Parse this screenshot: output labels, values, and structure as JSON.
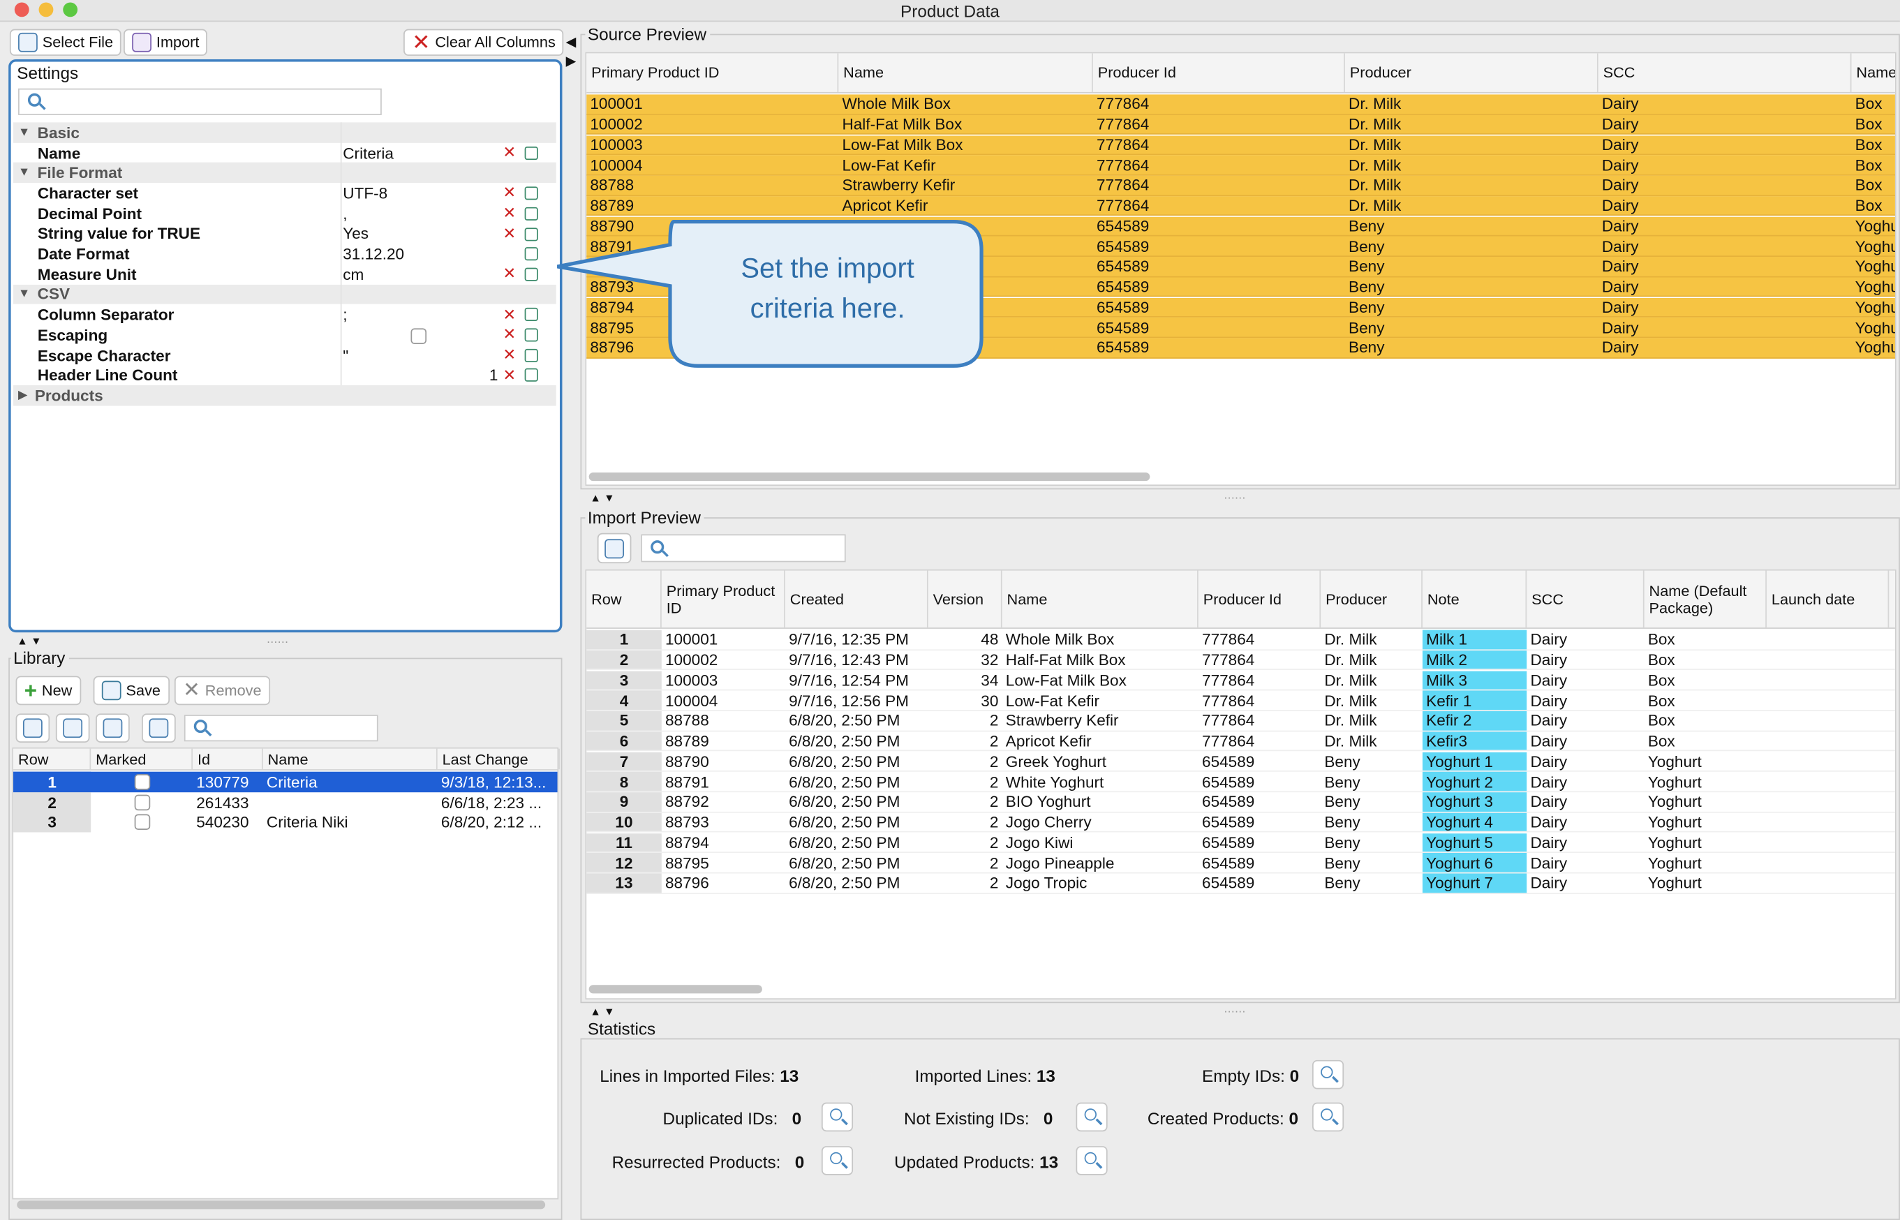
{
  "window": {
    "title": "Product Data"
  },
  "toolbar": {
    "select_file": "Select File",
    "import": "Import",
    "clear_all": "Clear All Columns"
  },
  "settings": {
    "title": "Settings",
    "groups": [
      {
        "label": "Basic",
        "items": [
          {
            "k": "Name",
            "v": "Criteria",
            "x": true
          }
        ]
      },
      {
        "label": "File Format",
        "items": [
          {
            "k": "Character set",
            "v": "UTF-8",
            "x": true
          },
          {
            "k": "Decimal Point",
            "v": ",",
            "x": true
          },
          {
            "k": "String value for TRUE",
            "v": "Yes",
            "x": true
          },
          {
            "k": "Date Format",
            "v": "31.12.20",
            "x": false
          },
          {
            "k": "Measure Unit",
            "v": "cm",
            "x": true
          }
        ]
      },
      {
        "label": "CSV",
        "items": [
          {
            "k": "Column Separator",
            "v": ";",
            "x": true
          },
          {
            "k": "Escaping",
            "v": "",
            "x": true,
            "checkbox": true
          },
          {
            "k": "Escape Character",
            "v": "\"",
            "x": true
          },
          {
            "k": "Header Line Count",
            "v": "1",
            "x": true,
            "right": true
          }
        ]
      }
    ],
    "collapsed_group": "Products"
  },
  "callout": {
    "line1": "Set the import",
    "line2": "criteria here."
  },
  "library": {
    "title": "Library",
    "new": "New",
    "save": "Save",
    "remove": "Remove",
    "columns": [
      "Row",
      "Marked",
      "Id",
      "Name",
      "Last Change"
    ],
    "rows": [
      {
        "row": "1",
        "id": "130779",
        "name": "Criteria",
        "last": "9/3/18, 12:13..."
      },
      {
        "row": "2",
        "id": "261433",
        "name": "",
        "last": "6/6/18, 2:23 ..."
      },
      {
        "row": "3",
        "id": "540230",
        "name": "Criteria Niki",
        "last": "6/8/20, 2:12 ..."
      }
    ]
  },
  "source": {
    "title": "Source Preview",
    "columns": [
      "Primary Product ID",
      "Name",
      "Producer Id",
      "Producer",
      "SCC",
      "Name"
    ],
    "rows": [
      [
        "100001",
        "Whole Milk Box",
        "777864",
        "Dr. Milk",
        "Dairy",
        "Box"
      ],
      [
        "100002",
        "Half-Fat Milk Box",
        "777864",
        "Dr. Milk",
        "Dairy",
        "Box"
      ],
      [
        "100003",
        "Low-Fat Milk Box",
        "777864",
        "Dr. Milk",
        "Dairy",
        "Box"
      ],
      [
        "100004",
        "Low-Fat Kefir",
        "777864",
        "Dr. Milk",
        "Dairy",
        "Box"
      ],
      [
        "88788",
        "Strawberry Kefir",
        "777864",
        "Dr. Milk",
        "Dairy",
        "Box"
      ],
      [
        "88789",
        "Apricot Kefir",
        "777864",
        "Dr. Milk",
        "Dairy",
        "Box"
      ],
      [
        "88790",
        "",
        "654589",
        "Beny",
        "Dairy",
        "Yoghu"
      ],
      [
        "88791",
        "",
        "654589",
        "Beny",
        "Dairy",
        "Yoghu"
      ],
      [
        "",
        "",
        "654589",
        "Beny",
        "Dairy",
        "Yoghu"
      ],
      [
        "88793",
        "",
        "654589",
        "Beny",
        "Dairy",
        "Yoghu"
      ],
      [
        "88794",
        "",
        "654589",
        "Beny",
        "Dairy",
        "Yoghu"
      ],
      [
        "88795",
        "",
        "654589",
        "Beny",
        "Dairy",
        "Yoghu"
      ],
      [
        "88796",
        "",
        "654589",
        "Beny",
        "Dairy",
        "Yoghu"
      ]
    ]
  },
  "import": {
    "title": "Import Preview",
    "columns": [
      "Row",
      "Primary Product ID",
      "Created",
      "Version",
      "Name",
      "Producer Id",
      "Producer",
      "Note",
      "SCC",
      "Name (Default Package)",
      "Launch date"
    ],
    "rows": [
      [
        "1",
        "100001",
        "9/7/16, 12:35 PM",
        "48",
        "Whole Milk Box",
        "777864",
        "Dr. Milk",
        "Milk 1",
        "Dairy",
        "Box"
      ],
      [
        "2",
        "100002",
        "9/7/16, 12:43 PM",
        "32",
        "Half-Fat Milk Box",
        "777864",
        "Dr. Milk",
        "Milk 2",
        "Dairy",
        "Box"
      ],
      [
        "3",
        "100003",
        "9/7/16, 12:54 PM",
        "34",
        "Low-Fat Milk Box",
        "777864",
        "Dr. Milk",
        "Milk 3",
        "Dairy",
        "Box"
      ],
      [
        "4",
        "100004",
        "9/7/16, 12:56 PM",
        "30",
        "Low-Fat Kefir",
        "777864",
        "Dr. Milk",
        "Kefir 1",
        "Dairy",
        "Box"
      ],
      [
        "5",
        "88788",
        "6/8/20, 2:50 PM",
        "2",
        "Strawberry Kefir",
        "777864",
        "Dr. Milk",
        "Kefir 2",
        "Dairy",
        "Box"
      ],
      [
        "6",
        "88789",
        "6/8/20, 2:50 PM",
        "2",
        "Apricot Kefir",
        "777864",
        "Dr. Milk",
        "Kefir3",
        "Dairy",
        "Box"
      ],
      [
        "7",
        "88790",
        "6/8/20, 2:50 PM",
        "2",
        "Greek Yoghurt",
        "654589",
        "Beny",
        "Yoghurt 1",
        "Dairy",
        "Yoghurt"
      ],
      [
        "8",
        "88791",
        "6/8/20, 2:50 PM",
        "2",
        "White Yoghurt",
        "654589",
        "Beny",
        "Yoghurt 2",
        "Dairy",
        "Yoghurt"
      ],
      [
        "9",
        "88792",
        "6/8/20, 2:50 PM",
        "2",
        "BIO Yoghurt",
        "654589",
        "Beny",
        "Yoghurt 3",
        "Dairy",
        "Yoghurt"
      ],
      [
        "10",
        "88793",
        "6/8/20, 2:50 PM",
        "2",
        "Jogo Cherry",
        "654589",
        "Beny",
        "Yoghurt 4",
        "Dairy",
        "Yoghurt"
      ],
      [
        "11",
        "88794",
        "6/8/20, 2:50 PM",
        "2",
        "Jogo Kiwi",
        "654589",
        "Beny",
        "Yoghurt 5",
        "Dairy",
        "Yoghurt"
      ],
      [
        "12",
        "88795",
        "6/8/20, 2:50 PM",
        "2",
        "Jogo Pineapple",
        "654589",
        "Beny",
        "Yoghurt 6",
        "Dairy",
        "Yoghurt"
      ],
      [
        "13",
        "88796",
        "6/8/20, 2:50 PM",
        "2",
        "Jogo Tropic",
        "654589",
        "Beny",
        "Yoghurt 7",
        "Dairy",
        "Yoghurt"
      ]
    ]
  },
  "statistics": {
    "title": "Statistics",
    "lines_label": "Lines in Imported Files:",
    "lines": "13",
    "imported_label": "Imported Lines:",
    "imported": "13",
    "empty_label": "Empty IDs:",
    "empty": "0",
    "dup_label": "Duplicated IDs:",
    "dup": "0",
    "notexist_label": "Not Existing IDs:",
    "notexist": "0",
    "created_label": "Created Products:",
    "created": "0",
    "resurrected_label": "Resurrected Products:",
    "resurrected": "0",
    "updated_label": "Updated Products:",
    "updated": "13"
  },
  "colors": {
    "source_row": "#f6c443",
    "note_cell": "#5fd8f6",
    "selection": "#1f5fd6",
    "focus_border": "#3d7fc1"
  }
}
